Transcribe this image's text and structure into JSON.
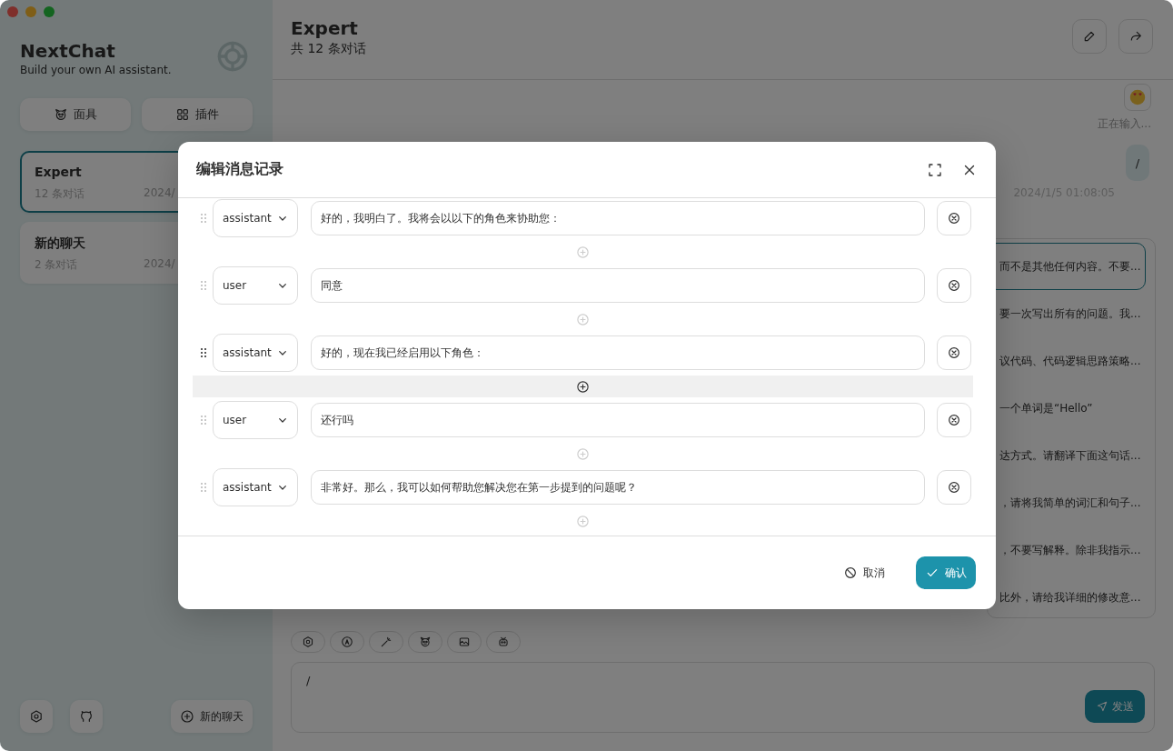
{
  "sidebar": {
    "title": "NextChat",
    "subtitle": "Build your own AI assistant.",
    "buttons": [
      {
        "label": "面具",
        "kind": "mask"
      },
      {
        "label": "插件",
        "kind": "plugin"
      }
    ],
    "sessions": [
      {
        "title": "Expert",
        "count": "12 条对话",
        "date": "2024/",
        "selected": true
      },
      {
        "title": "新的聊天",
        "count": "2 条对话",
        "date": "2024/",
        "selected": false
      }
    ],
    "new_chat": "新的聊天"
  },
  "chat": {
    "title": "Expert",
    "subtitle": "共 12 条对话",
    "typing": "正在输入...",
    "user_message": "/",
    "message_time": "2024/1/5 01:08:05",
    "prompts": [
      {
        "text": "而不是其他任何内容。不要...",
        "selected": true
      },
      {
        "text": "要一次写出所有的问题。我...",
        "selected": false
      },
      {
        "text": "议代码、代码逻辑思路策略...",
        "selected": false
      },
      {
        "text": "一个单词是“Hello”",
        "selected": false
      },
      {
        "text": "达方式。请翻译下面这句话...",
        "selected": false
      },
      {
        "text": "，请将我简单的词汇和句子...",
        "selected": false
      },
      {
        "text": "，不要写解释。除非我指示...",
        "selected": false
      },
      {
        "text": "比外，请给我详细的修改意...",
        "selected": false
      }
    ],
    "input_value": "/",
    "send": "发送"
  },
  "modal": {
    "title": "编辑消息记录",
    "messages": [
      {
        "role": "assistant",
        "content": "好的，我明白了。我将会以以下的角色来协助您：",
        "insert_hovered": false
      },
      {
        "role": "user",
        "content": "同意",
        "insert_hovered": false
      },
      {
        "role": "assistant",
        "content": "好的，现在我已经启用以下角色：",
        "insert_hovered": true
      },
      {
        "role": "user",
        "content": "还行吗",
        "insert_hovered": false
      },
      {
        "role": "assistant",
        "content": "非常好。那么，我可以如何帮助您解决您在第一步提到的问题呢？",
        "insert_hovered": false
      }
    ],
    "cancel": "取消",
    "confirm": "确认"
  }
}
